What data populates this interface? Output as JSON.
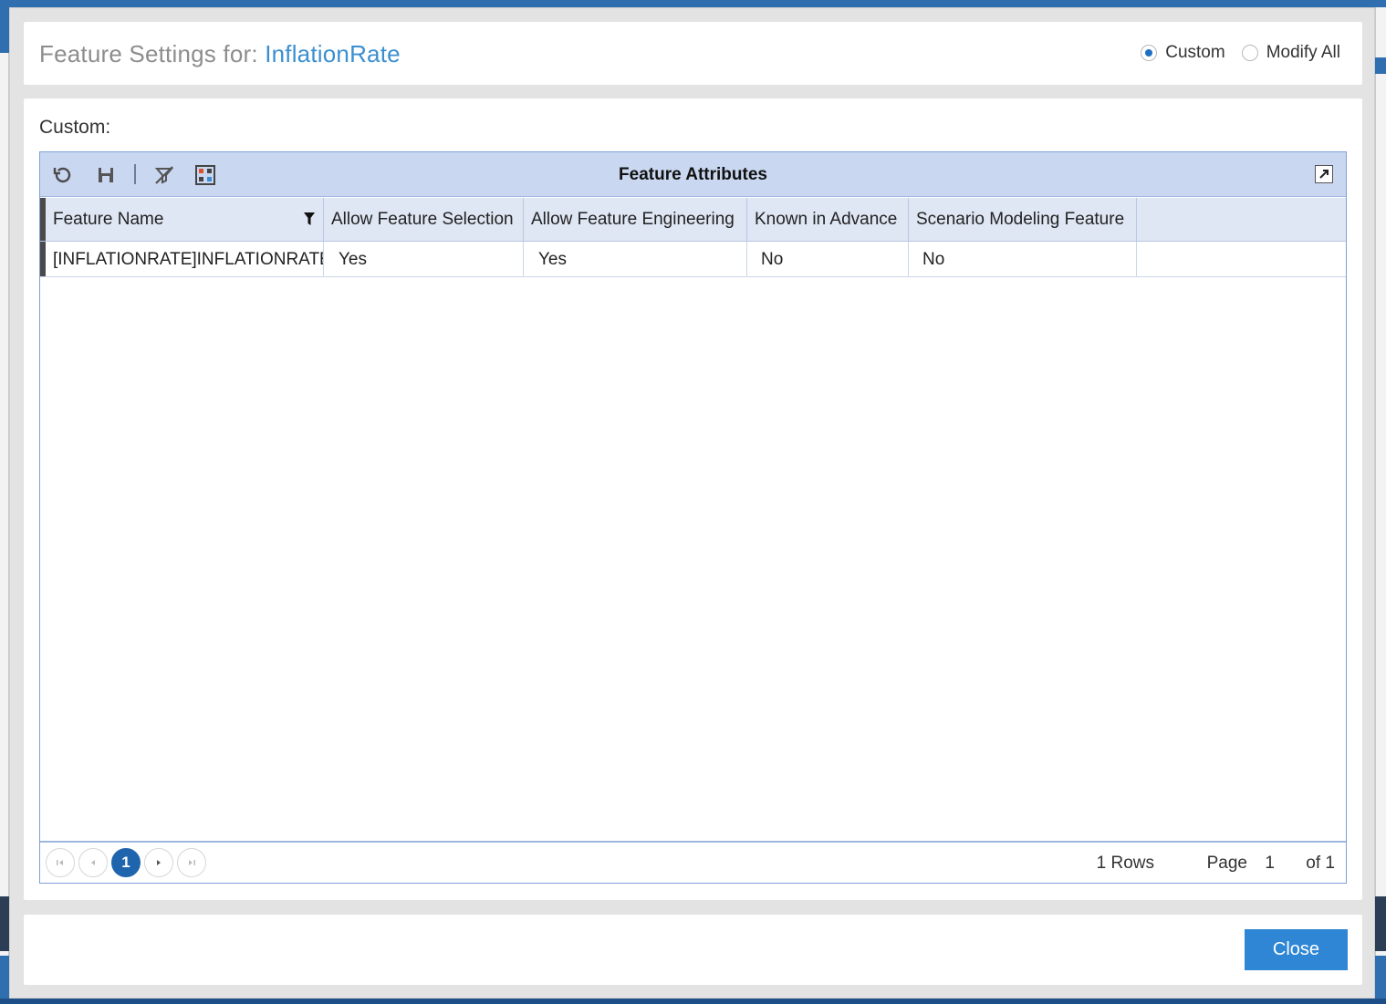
{
  "modal": {
    "title_prefix": "Feature Settings for:",
    "title_feature": "InflationRate",
    "mode_options": [
      {
        "label": "Custom",
        "checked": true
      },
      {
        "label": "Modify All",
        "checked": false
      }
    ],
    "section_label": "Custom:",
    "close_label": "Close"
  },
  "grid": {
    "title": "Feature Attributes",
    "toolbar_icons": [
      "refresh-icon",
      "save-icon",
      "clear-filter-icon",
      "column-chooser-icon"
    ],
    "columns": [
      "Feature Name",
      "Allow Feature Selection",
      "Allow Feature Engineering",
      "Known in Advance",
      "Scenario Modeling Feature"
    ],
    "rows": [
      [
        "[INFLATIONRATE]INFLATIONRATE",
        "Yes",
        "Yes",
        "No",
        "No"
      ]
    ]
  },
  "pager": {
    "current_page": "1",
    "rows_text": "1 Rows",
    "page_label": "Page",
    "page_number": "1",
    "of_text": "of 1"
  },
  "colors": {
    "accent": "#3b8fd1",
    "toolbar_bg": "#c9d7f0",
    "button": "#2f86d4",
    "pager_current": "#1f65ad"
  }
}
